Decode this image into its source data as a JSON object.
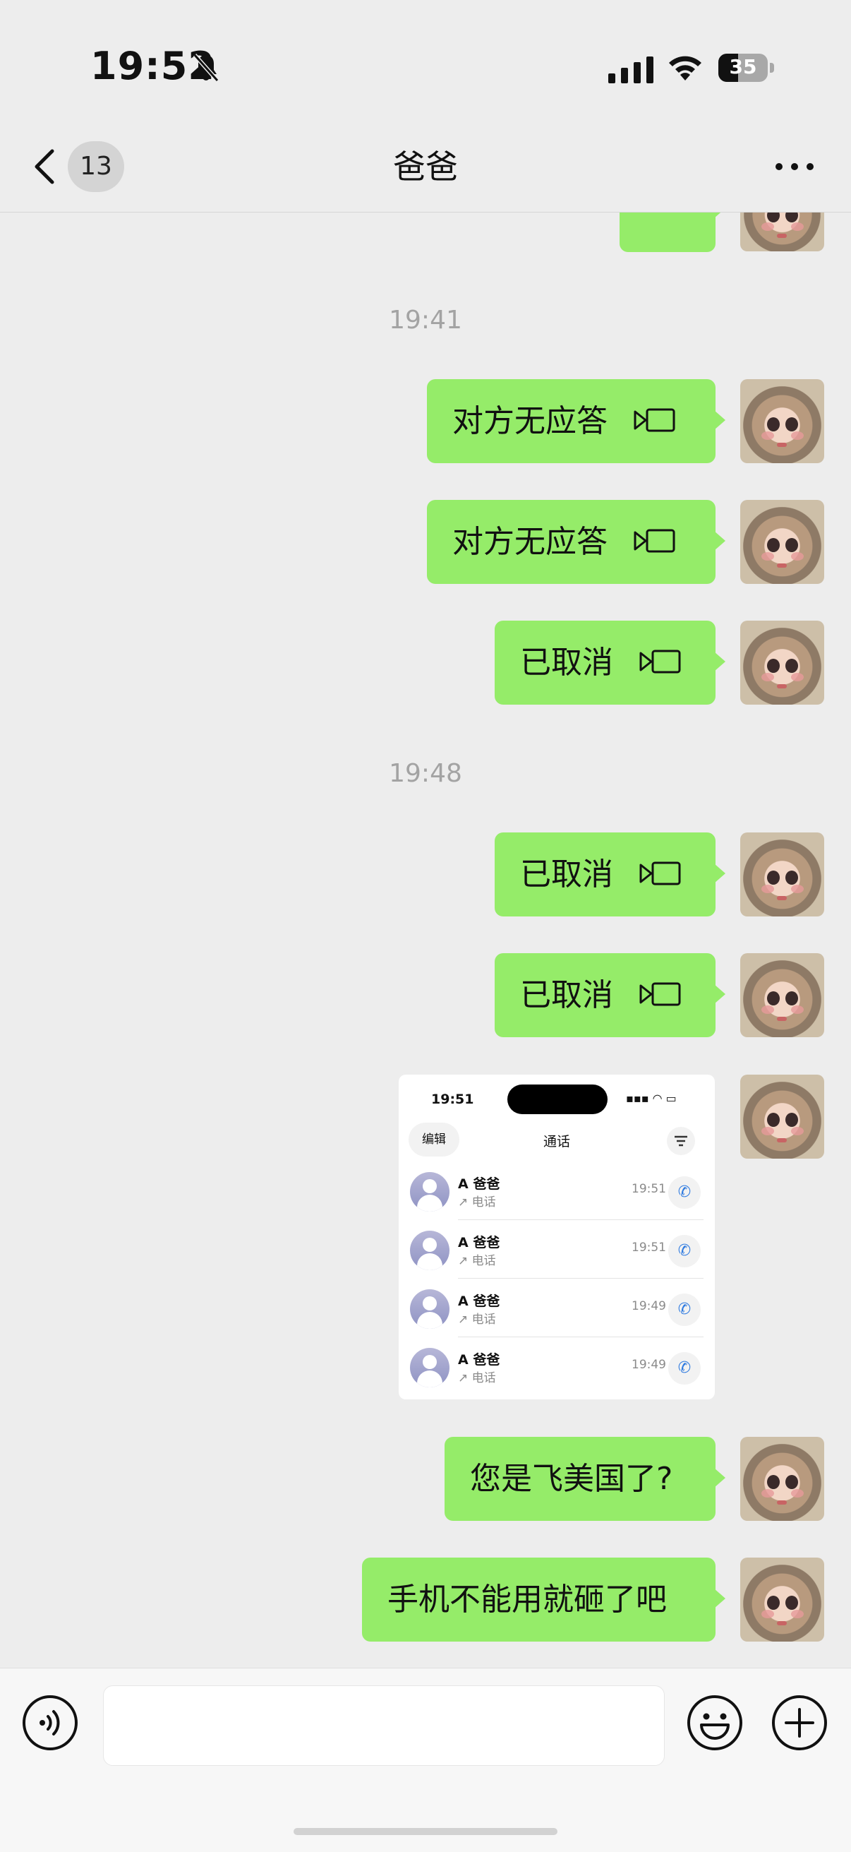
{
  "status_bar": {
    "time": "19:52",
    "battery": "35"
  },
  "nav": {
    "back_count": "13",
    "title": "爸爸"
  },
  "partial_message": "?",
  "timestamps": [
    "19:41",
    "19:48"
  ],
  "messages": [
    {
      "text": "对方无应答",
      "kind": "video-call"
    },
    {
      "text": "对方无应答",
      "kind": "video-call"
    },
    {
      "text": "已取消",
      "kind": "video-call"
    },
    {
      "text": "已取消",
      "kind": "video-call"
    },
    {
      "text": "已取消",
      "kind": "video-call"
    },
    {
      "text": "您是飞美国了?",
      "kind": "text"
    },
    {
      "text": "手机不能用就砸了吧",
      "kind": "text"
    }
  ],
  "screenshot": {
    "time": "19:51",
    "edit_label": "编辑",
    "title": "通话",
    "rows": [
      {
        "name": "A 爸爸",
        "type": "电话",
        "time": "19:51"
      },
      {
        "name": "A 爸爸",
        "type": "电话",
        "time": "19:51"
      },
      {
        "name": "A 爸爸",
        "type": "电话",
        "time": "19:49"
      },
      {
        "name": "A 爸爸",
        "type": "电话",
        "time": "19:49"
      }
    ]
  },
  "icons": {
    "status": [
      "bell-slash-icon",
      "cellular-signal-icon",
      "wifi-icon",
      "battery-icon"
    ],
    "nav": [
      "chevron-left-icon",
      "more-icon"
    ],
    "message": "video-call-icon",
    "input": [
      "voice-icon",
      "emoji-icon",
      "plus-icon"
    ]
  },
  "colors": {
    "bubble": "#95EC69",
    "background": "#EDEDED",
    "timestamp": "#A3A3A3",
    "call_blue": "#2F7BE0"
  }
}
